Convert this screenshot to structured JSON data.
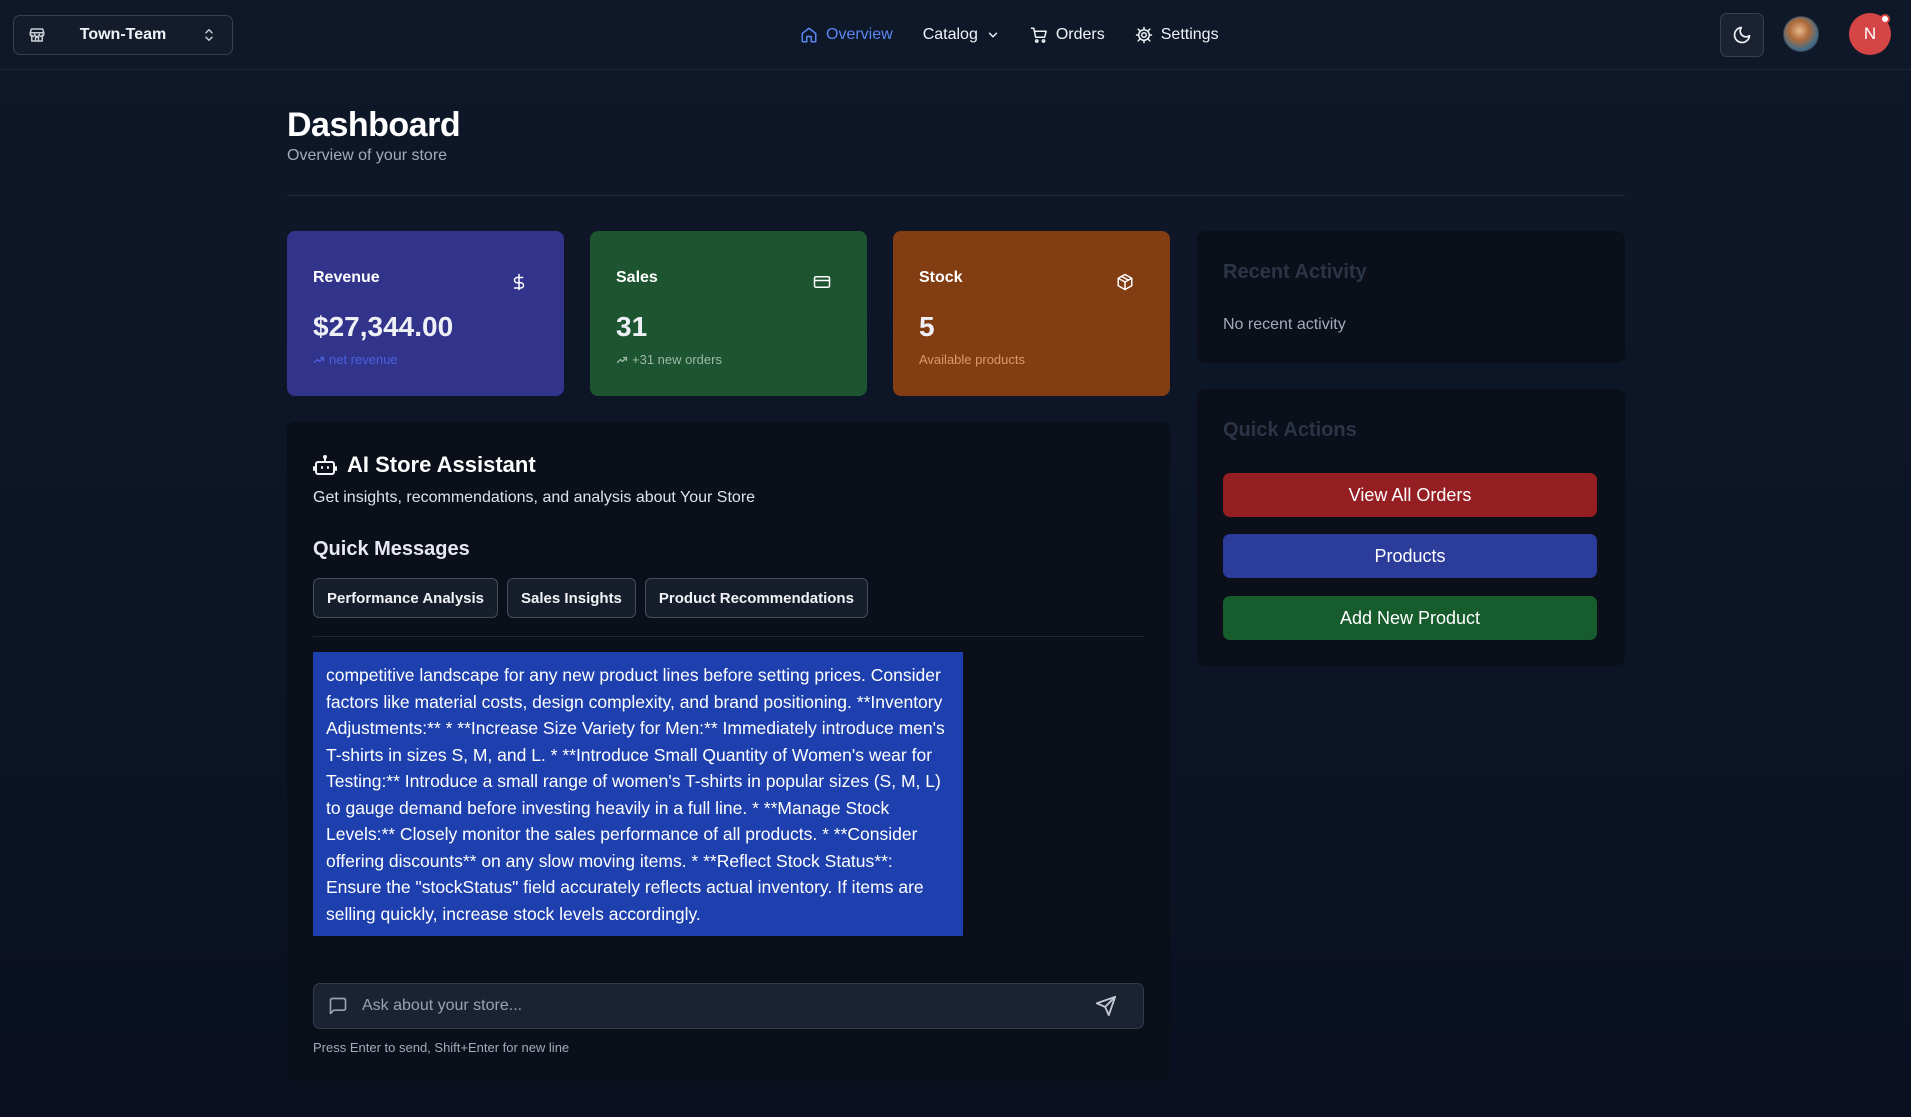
{
  "topbar": {
    "store_name": "Town-Team",
    "nav": [
      {
        "label": "Overview",
        "icon": "home-icon",
        "active": true
      },
      {
        "label": "Catalog",
        "icon": "chevron-down-icon",
        "active": false
      },
      {
        "label": "Orders",
        "icon": "cart-icon",
        "active": false
      },
      {
        "label": "Settings",
        "icon": "gear-icon",
        "active": false
      }
    ],
    "user_initial": "N"
  },
  "header": {
    "title": "Dashboard",
    "subtitle": "Overview of your store"
  },
  "stats": {
    "revenue": {
      "label": "Revenue",
      "value": "$27,344.00",
      "note": "net revenue",
      "icon": "dollar-icon",
      "color": "#32338a"
    },
    "sales": {
      "label": "Sales",
      "value": "31",
      "note": "+31 new orders",
      "icon": "credit-card-icon",
      "color": "#1c5530"
    },
    "stock": {
      "label": "Stock",
      "value": "5",
      "note": "Available products",
      "icon": "package-icon",
      "color": "#823d13"
    }
  },
  "recent_activity": {
    "title": "Recent Activity",
    "empty_text": "No recent activity"
  },
  "quick_actions": {
    "title": "Quick Actions",
    "buttons": [
      {
        "label": "View All Orders",
        "color": "#941e21"
      },
      {
        "label": "Products",
        "color": "#2c3c9a"
      },
      {
        "label": "Add New Product",
        "color": "#175c2c"
      }
    ]
  },
  "assistant": {
    "title": "AI Store Assistant",
    "description": "Get insights, recommendations, and analysis about Your Store",
    "quick_messages_title": "Quick Messages",
    "quick_messages": [
      "Performance Analysis",
      "Sales Insights",
      "Product Recommendations"
    ],
    "message": "competitive landscape for any new product lines before setting prices. Consider factors like material costs, design complexity, and brand positioning. **Inventory Adjustments:** * **Increase Size Variety for Men:** Immediately introduce men's T-shirts in sizes S, M, and L. * **Introduce Small Quantity of Women's wear for Testing:** Introduce a small range of women's T-shirts in popular sizes (S, M, L) to gauge demand before investing heavily in a full line. * **Manage Stock Levels:** Closely monitor the sales performance of all products. * **Consider offering discounts** on any slow moving items. * **Reflect Stock Status**: Ensure the \"stockStatus\" field accurately reflects actual inventory. If items are selling quickly, increase stock levels accordingly.",
    "input_placeholder": "Ask about your store...",
    "input_value": "",
    "hint": "Press Enter to send, Shift+Enter for new line"
  }
}
